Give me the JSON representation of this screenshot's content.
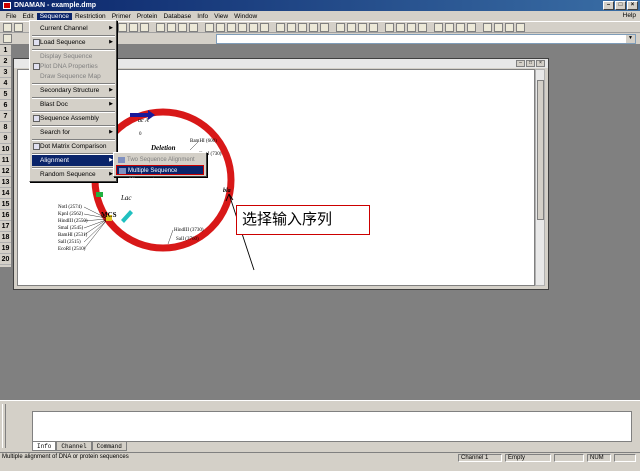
{
  "titlebar": {
    "title": "DNAMAN - example.dmp"
  },
  "menubar": {
    "items": [
      "File",
      "Edit",
      "Sequence",
      "Restriction",
      "Primer",
      "Protein",
      "Database",
      "Info",
      "View",
      "Window"
    ],
    "help": "Help"
  },
  "channels": [
    "1",
    "2",
    "3",
    "4",
    "5",
    "6",
    "7",
    "8",
    "9",
    "10",
    "11",
    "12",
    "13",
    "14",
    "15",
    "16",
    "17",
    "18",
    "19",
    "20"
  ],
  "sequence_menu": {
    "items": [
      {
        "label": "Current Channel",
        "submenu": true
      },
      {
        "label": "Load Sequence",
        "submenu": true
      },
      {
        "label": "Display Sequence",
        "disabled": true
      },
      {
        "label": "Plot DNA Properties",
        "disabled": true
      },
      {
        "label": "Draw Sequence Map",
        "disabled": true
      },
      {
        "label": "Secondary Structure",
        "submenu": true
      },
      {
        "label": "Blast Doc",
        "submenu": true
      },
      {
        "label": "Sequence Assembly"
      },
      {
        "label": "Search for",
        "submenu": true
      },
      {
        "label": "Dot Matrix Comparison"
      },
      {
        "label": "Alignment",
        "submenu": true,
        "highlighted": true
      },
      {
        "label": "Random Sequence",
        "submenu": true
      }
    ]
  },
  "alignment_submenu": {
    "items": [
      {
        "label": "Two Sequence Alignment",
        "disabled": true
      },
      {
        "label": "Multiple Sequence Alignment",
        "highlighted": true
      }
    ]
  },
  "plasmid": {
    "labels": {
      "deletion": "Deletion",
      "lac": "Lac",
      "mcs": "MCS",
      "top_partial": "ac A",
      "right_partial": "bla",
      "small_zero": "0"
    },
    "sites_right": [
      "BamHI (600)",
      "XpnI (730)",
      "HindIII (3730)",
      "SalI (3760)"
    ],
    "sites_left": [
      "NotI (2574)",
      "KpnI (2562)",
      "HindIII (2550)",
      "SmaI (2545)",
      "BamHI (2531)",
      "SalI (2515)",
      "EcoRI (2510)"
    ]
  },
  "annotation": {
    "text": "选择输入序列"
  },
  "bottom_tabs": [
    "Info",
    "Channel",
    "Command"
  ],
  "status": {
    "message": "Multiple alignment of DNA or protein sequences",
    "channel": "Channel 1",
    "state": "Empty",
    "num": "NUM"
  }
}
